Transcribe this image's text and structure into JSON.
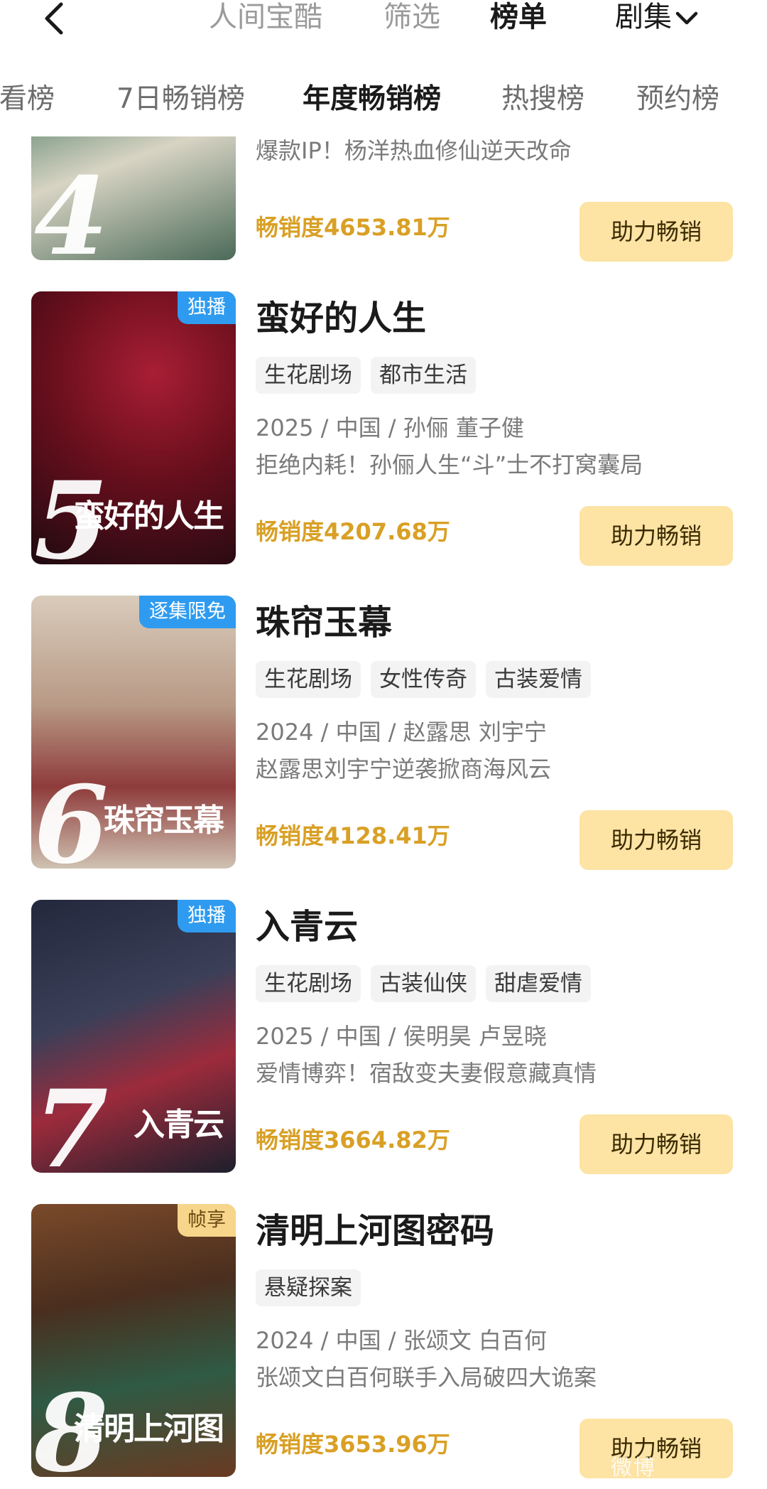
{
  "header": {
    "tabs": [
      {
        "label": "人间宝酷",
        "active": false
      },
      {
        "label": "筛选",
        "active": false
      },
      {
        "label": "榜单",
        "active": true
      }
    ],
    "dropdown_label": "剧集"
  },
  "subtabs": [
    {
      "label": "必看榜",
      "active": false
    },
    {
      "label": "7日畅销榜",
      "active": false
    },
    {
      "label": "年度畅销榜",
      "active": true
    },
    {
      "label": "热搜榜",
      "active": false
    },
    {
      "label": "预约榜",
      "active": false
    }
  ],
  "items": [
    {
      "rank": "4",
      "badge": "",
      "title": "",
      "tags": [],
      "meta": "",
      "desc": "爆款IP！杨洋热血修仙逆天改命",
      "sales": "畅销度4653.81万",
      "button": "助力畅销",
      "poster_text": "",
      "colors": [
        "#5d7a6a",
        "#c9c9b8"
      ]
    },
    {
      "rank": "5",
      "badge": "独播",
      "badge_style": "blue",
      "title": "蛮好的人生",
      "tags": [
        "生花剧场",
        "都市生活"
      ],
      "meta": "2025 / 中国 / 孙俪 董子健",
      "desc": "拒绝内耗！孙俪人生“斗”士不打窝囊局",
      "sales": "畅销度4207.68万",
      "button": "助力畅销",
      "poster_text": "蛮好的人生",
      "colors": [
        "#7a1020",
        "#2b0d14"
      ]
    },
    {
      "rank": "6",
      "badge": "逐集限免",
      "badge_style": "blue",
      "title": "珠帘玉幕",
      "tags": [
        "生花剧场",
        "女性传奇",
        "古装爱情"
      ],
      "meta": "2024 / 中国 / 赵露思 刘宇宁",
      "desc": "赵露思刘宇宁逆袭掀商海风云",
      "sales": "畅销度4128.41万",
      "button": "助力畅销",
      "poster_text": "珠帘玉幕",
      "colors": [
        "#c9b8a6",
        "#8a3a3a"
      ]
    },
    {
      "rank": "7",
      "badge": "独播",
      "badge_style": "blue",
      "title": "入青云",
      "tags": [
        "生花剧场",
        "古装仙侠",
        "甜虐爱情"
      ],
      "meta": "2025 / 中国 / 侯明昊 卢昱晓",
      "desc": "爱情博弈！宿敌变夫妻假意藏真情",
      "sales": "畅销度3664.82万",
      "button": "助力畅销",
      "poster_text": "入青云",
      "colors": [
        "#2a2f45",
        "#9a2a3a"
      ]
    },
    {
      "rank": "8",
      "badge": "帧享",
      "badge_style": "gold",
      "title": "清明上河图密码",
      "tags": [
        "悬疑探案"
      ],
      "meta": "2024 / 中国 / 张颂文 白百何",
      "desc": "张颂文白百何联手入局破四大诡案",
      "sales": "畅销度3653.96万",
      "button": "助力畅销",
      "poster_text": "清明上河图",
      "colors": [
        "#6a3a20",
        "#2a4a3a"
      ]
    }
  ],
  "watermark": "微博"
}
